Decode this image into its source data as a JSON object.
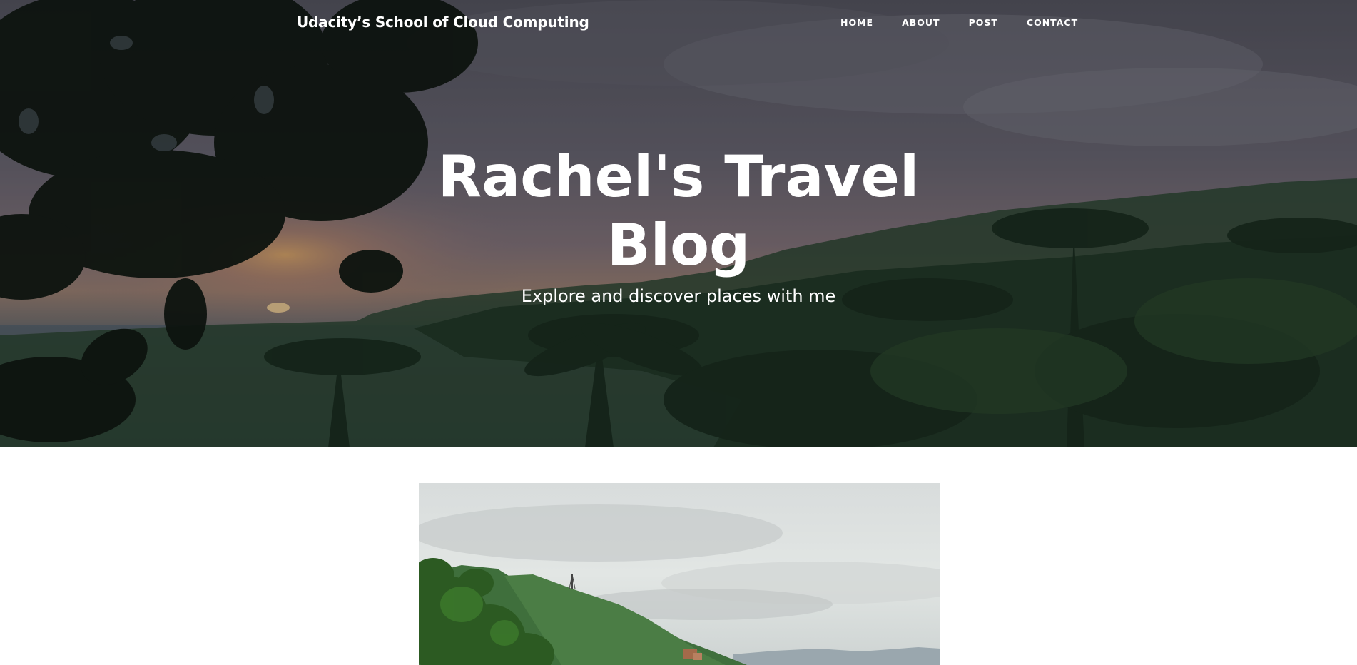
{
  "navbar": {
    "brand": "Udacity’s School of Cloud Computing",
    "links": [
      {
        "label": "HOME"
      },
      {
        "label": "ABOUT"
      },
      {
        "label": "POST"
      },
      {
        "label": "CONTACT"
      }
    ]
  },
  "hero": {
    "title": "Rachel's Travel Blog",
    "subtitle": "Explore and discover places with me",
    "overlay_color": "#000000"
  },
  "post": {
    "image_name": "mountain-landscape-photo"
  }
}
